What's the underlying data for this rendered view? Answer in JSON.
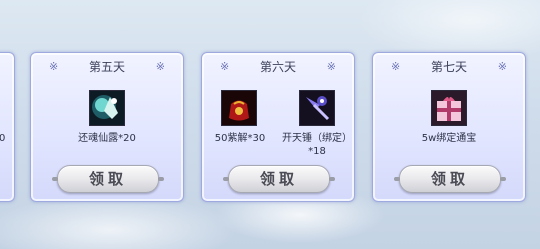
{
  "cards": [
    {
      "day_label": "第五天",
      "items": [
        {
          "name": "还魂仙露*20",
          "icon": "potion-icon"
        }
      ],
      "button_label": "领取"
    },
    {
      "day_label": "第六天",
      "items": [
        {
          "name": "50紫解*30",
          "icon": "pouch-icon"
        },
        {
          "name": "开天锤（绑定）*18",
          "icon": "hammer-icon"
        }
      ],
      "button_label": "领取"
    },
    {
      "day_label": "第七天",
      "items": [
        {
          "name": "5w绑定通宝",
          "icon": "gift-box-icon"
        }
      ],
      "button_label": "领取"
    }
  ],
  "partial_card": {
    "visible_text": "0"
  },
  "decoration": {
    "corner_symbol": "※"
  },
  "colors": {
    "card_border": "#9ea9df",
    "card_bg": "#e2e6ff",
    "title_text": "#3b3f58"
  }
}
